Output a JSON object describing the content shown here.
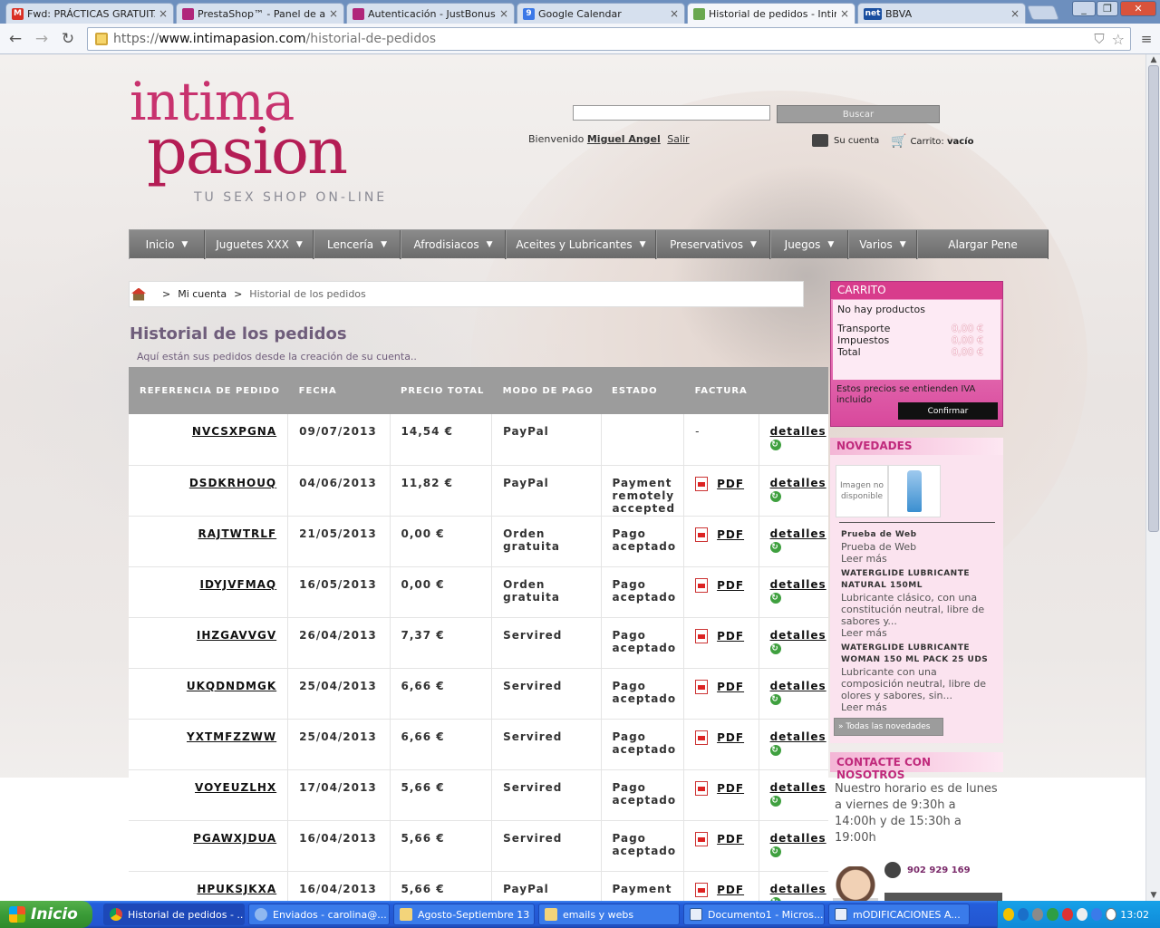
{
  "browser": {
    "tabs": [
      {
        "label": "Fwd: PRÁCTICAS GRATUITAS",
        "icon": "gmail-icon",
        "color": "#d93025"
      },
      {
        "label": "PrestaShop™ - Panel de administración",
        "icon": "prestashop-icon",
        "color": "#b0267a"
      },
      {
        "label": "Autenticación - JustBonus",
        "icon": "justbonus-icon",
        "color": "#b0267a"
      },
      {
        "label": "Google Calendar",
        "icon": "calendar-icon",
        "color": "#3b78e7"
      },
      {
        "label": "Historial de pedidos - Intima",
        "icon": "intimapasion-icon",
        "color": "#6aa84f"
      },
      {
        "label": "BBVA",
        "icon": "bbva-icon",
        "color": "#1a4fa0"
      }
    ],
    "url_protocol": "https://",
    "url_host": "www.intimapasion.com",
    "url_path": "/historial-de-pedidos"
  },
  "header": {
    "logo_line1": "intima",
    "logo_line2": "pasion",
    "logo_tagline": "TU SEX SHOP ON-LINE",
    "search_button": "Buscar",
    "welcome": "Bienvenido",
    "user_name": "Miguel Angel",
    "logout": "Salir",
    "account_label": "Su cuenta",
    "cart_label": "Carrito:",
    "cart_value": "vacío"
  },
  "nav": [
    {
      "label": "Inicio",
      "dropdown": true
    },
    {
      "label": "Juguetes XXX",
      "dropdown": true
    },
    {
      "label": "Lencería",
      "dropdown": true
    },
    {
      "label": "Afrodisiacos",
      "dropdown": true
    },
    {
      "label": "Aceites y Lubricantes",
      "dropdown": true
    },
    {
      "label": "Preservativos",
      "dropdown": true
    },
    {
      "label": "Juegos",
      "dropdown": true
    },
    {
      "label": "Varios",
      "dropdown": true
    },
    {
      "label": "Alargar Pene",
      "dropdown": false
    }
  ],
  "breadcrumb": {
    "sep": ">",
    "account": "Mi cuenta",
    "current": "Historial de los pedidos"
  },
  "main": {
    "title": "Historial de los pedidos",
    "subtitle": "Aquí están sus pedidos desde la creación de su cuenta.."
  },
  "orders": {
    "headers": [
      "REFERENCIA DE PEDIDO",
      "FECHA",
      "PRECIO TOTAL",
      "MODO DE PAGO",
      "ESTADO",
      "FACTURA",
      ""
    ],
    "details_label": "detalles",
    "pdf_label": "PDF",
    "rows": [
      {
        "ref": "NVCSXPGNA",
        "date": "09/07/2013",
        "total": "14,54 €",
        "payment": "PayPal",
        "state": "",
        "invoice": "-"
      },
      {
        "ref": "DSDKRHOUQ",
        "date": "04/06/2013",
        "total": "11,82 €",
        "payment": "PayPal",
        "state": "Payment remotely accepted",
        "invoice": "PDF"
      },
      {
        "ref": "RAJTWTRLF",
        "date": "21/05/2013",
        "total": "0,00 €",
        "payment": "Orden gratuita",
        "state": "Pago aceptado",
        "invoice": "PDF"
      },
      {
        "ref": "IDYJVFMAQ",
        "date": "16/05/2013",
        "total": "0,00 €",
        "payment": "Orden gratuita",
        "state": "Pago aceptado",
        "invoice": "PDF"
      },
      {
        "ref": "IHZGAVVGV",
        "date": "26/04/2013",
        "total": "7,37 €",
        "payment": "Servired",
        "state": "Pago aceptado",
        "invoice": "PDF"
      },
      {
        "ref": "UKQDNDMGK",
        "date": "25/04/2013",
        "total": "6,66 €",
        "payment": "Servired",
        "state": "Pago aceptado",
        "invoice": "PDF"
      },
      {
        "ref": "YXTMFZZWW",
        "date": "25/04/2013",
        "total": "6,66 €",
        "payment": "Servired",
        "state": "Pago aceptado",
        "invoice": "PDF"
      },
      {
        "ref": "VOYEUZLHX",
        "date": "17/04/2013",
        "total": "5,66 €",
        "payment": "Servired",
        "state": "Pago aceptado",
        "invoice": "PDF"
      },
      {
        "ref": "PGAWXJDUA",
        "date": "16/04/2013",
        "total": "5,66 €",
        "payment": "Servired",
        "state": "Pago aceptado",
        "invoice": "PDF"
      },
      {
        "ref": "HPUKSJKXA",
        "date": "16/04/2013",
        "total": "5,66 €",
        "payment": "PayPal",
        "state": "Payment",
        "invoice": "PDF"
      }
    ]
  },
  "cart_block": {
    "title": "CARRITO",
    "empty": "No hay productos",
    "shipping_label": "Transporte",
    "shipping": "0,00 €",
    "tax_label": "Impuestos",
    "tax": "0,00 €",
    "total_label": "Total",
    "total": "0,00 €",
    "note": "Estos precios se entienden IVA incluido",
    "confirm": "Confirmar"
  },
  "news_block": {
    "title": "NOVEDADES",
    "noimg": "Imagen no disponible",
    "items": [
      {
        "title": "Prueba de Web",
        "desc": "Prueba de Web",
        "more": "Leer más"
      },
      {
        "title": "WATERGLIDE LUBRICANTE NATURAL 150ML",
        "desc": "Lubricante clásico, con una constitución neutral, libre de sabores y...",
        "more": "Leer más"
      },
      {
        "title": "WATERGLIDE LUBRICANTE WOMAN 150 ML PACK 25 UDS",
        "desc": "Lubricante con una composición neutral,  libre de olores y sabores, sin...",
        "more": "Leer más"
      }
    ],
    "all": "» Todas las novedades"
  },
  "contact_block": {
    "title": "CONTACTE CON NOSOTROS",
    "hours": "Nuestro horario es de lunes a viernes de 9:30h a 14:00h y de 15:30h a 19:00h",
    "phone": "902 929 169"
  },
  "taskbar": {
    "start": "Inicio",
    "items": [
      {
        "label": "Historial de pedidos - ...",
        "icon": "chrome-icon",
        "active": true
      },
      {
        "label": "Enviados - carolina@...",
        "icon": "mail-icon",
        "active": false
      },
      {
        "label": "Agosto-Septiembre 13",
        "icon": "folder-icon",
        "active": false
      },
      {
        "label": "emails y webs",
        "icon": "folder-icon",
        "active": false
      },
      {
        "label": "Documento1 - Micros...",
        "icon": "word-icon",
        "active": false
      },
      {
        "label": "mODIFICACIONES A...",
        "icon": "word-icon",
        "active": false
      }
    ],
    "clock": "13:02"
  }
}
